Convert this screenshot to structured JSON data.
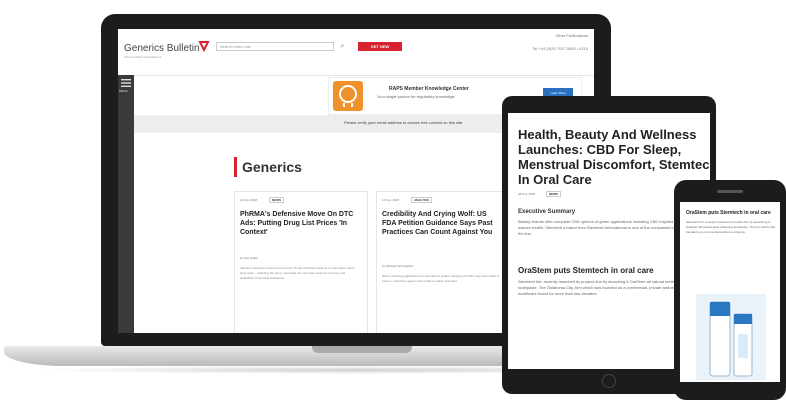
{
  "laptop": {
    "logo": {
      "text": "Generics Bulletin",
      "tagline": "Informa Pharma Intelligence"
    },
    "search": {
      "placeholder": "Search entire site"
    },
    "header": {
      "signin_label": "GET NEW",
      "top_link": "Other Publications",
      "contact": "Tel +44 (0)20 7017 5540 / 4215"
    },
    "rail": {
      "menu_label": "MENU"
    },
    "banner": {
      "title": "RAPS Member Knowledge Center",
      "subtitle": "Your single source for regulatory knowledge",
      "button": "Learn More"
    },
    "verify_text": "Please verify your email address to access free content on this site.",
    "section_title": "Generics",
    "cards": [
      {
        "date": "13 Nov 2018",
        "tag": "NEWS",
        "title": "PhRMA's Defensive Move On DTC Ads: Putting Drug List Prices 'In Context'",
        "author": "by Sue Sutter",
        "body": "Industry companies' direct-to-consumer TV ads will direct patients to information about drug costs – including the price, estimated out-of-pocket costs for the drug, and availability of financial assistance."
      },
      {
        "date": "13 Nov 2018",
        "tag": "ANALYSIS",
        "title": "Credibility And Crying Wolf: US FDA Petition Guidance Says Past Practices Can Count Against You",
        "author": "by Michael McCaughan",
        "body": "When reviewing applicants that submitted a petition delaying the FDA may factor back to cases in which the agency found that a petition was filed."
      }
    ]
  },
  "tablet": {
    "title": "Health, Beauty And Wellness Launches: CBD For Sleep, Menstrual Discomfort, Stemtech In Oral Care",
    "date": "08 Nov 2018",
    "tag": "NEWS",
    "exec_label": "Executive Summary",
    "summary": "Beauty brands offer complete CBD options of green applications including CBD inspired product for women health. Stemtech a brand from Stemtech International is one of the companies in regulations and the line.",
    "subhead": "OraStem puts Stemtech in oral care",
    "body": "Stemtech Intl. recently launched its product line by launching it OraStem all natural teeth whitening toothpaste. The Oklahoma City, firm which was founded as a commercial, private wellness and healthcare brand for more than two decades."
  },
  "phone": {
    "title": "OraStem puts Stemtech in oral care",
    "body": "Stemtech Intl. recently launched its product line by launching its OraStem all natural teeth whitening toothpaste. The firm which was founded as a commercial wellness company.",
    "product_label": "OraStem"
  },
  "colors": {
    "brand_red": "#d6232e",
    "device_frame": "#1c1c1e",
    "banner_orange": "#f0922b",
    "button_blue": "#2b6fbf"
  }
}
